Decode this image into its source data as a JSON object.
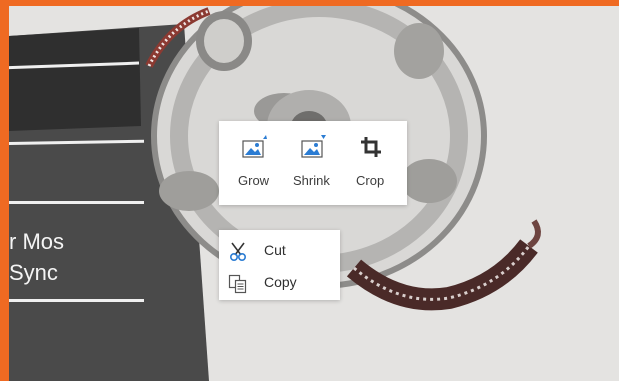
{
  "background": {
    "frame_color": "#ef6a22",
    "clapperboard_text": [
      "r Mos",
      "Sync"
    ]
  },
  "image_toolbar": {
    "buttons": [
      {
        "label": "Grow",
        "icon": "grow-picture-icon"
      },
      {
        "label": "Shrink",
        "icon": "shrink-picture-icon"
      },
      {
        "label": "Crop",
        "icon": "crop-icon"
      }
    ],
    "icon_accent": "#2b7cd3"
  },
  "context_menu": {
    "items": [
      {
        "label": "Cut",
        "icon": "scissors-icon"
      },
      {
        "label": "Copy",
        "icon": "copy-icon"
      }
    ]
  }
}
